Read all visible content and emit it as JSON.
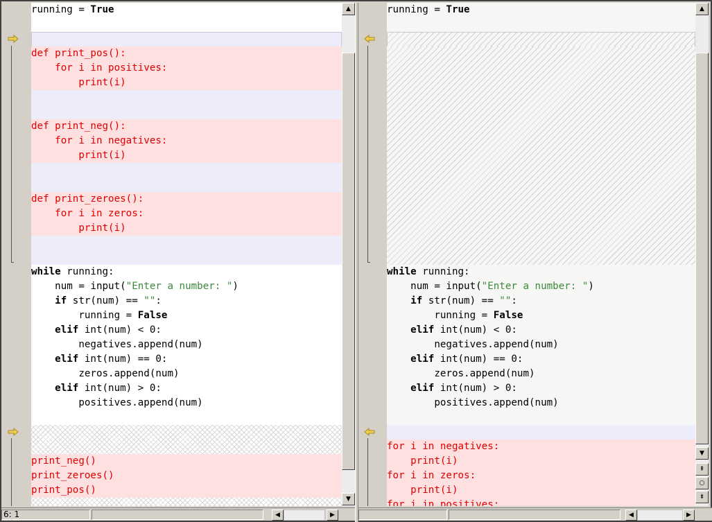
{
  "left": {
    "top_line": "running = True",
    "functions": [
      {
        "def": "def print_pos():",
        "for": "    for i in positives:",
        "print": "        print(i)"
      },
      {
        "def": "def print_neg():",
        "for": "    for i in negatives:",
        "print": "        print(i)"
      },
      {
        "def": "def print_zeroes():",
        "for": "    for i in zeros:",
        "print": "        print(i)"
      }
    ],
    "calls": [
      "print_neg()",
      "print_zeroes()",
      "print_pos()"
    ]
  },
  "right": {
    "top_line": "running = True",
    "loops": [
      "for i in negatives:",
      "    print(i)",
      "for i in zeros:",
      "    print(i)",
      "for i in positives:"
    ]
  },
  "while_block": {
    "l1_kw": "while",
    "l1_rest": " running:",
    "l2_a": "    num = input(",
    "l2_str": "\"Enter a number: \"",
    "l2_b": ")",
    "l3_kw": "    if",
    "l3_rest": " str(num) == ",
    "l3_str": "\"\"",
    "l3_end": ":",
    "l4_a": "        running = ",
    "l4_kw": "False",
    "l5_kw": "    elif",
    "l5_rest": " int(num) < 0:",
    "l6": "        negatives.append(num)",
    "l7_kw": "    elif",
    "l7_rest": " int(num) == 0:",
    "l8": "        zeros.append(num)",
    "l9_kw": "    elif",
    "l9_rest": " int(num) > 0:",
    "l10": "        positives.append(num)"
  },
  "status": {
    "position": "6: 1"
  },
  "colors": {
    "deleted_text": "#e00000",
    "deleted_bg": "#ffe0e0",
    "string": "#3a8a3a",
    "arrow": "#e8c030"
  },
  "icons": {
    "change_marker": "arrow-right-icon",
    "nav_up": "double-up-icon",
    "nav_center": "circle-icon",
    "nav_down": "double-down-icon"
  }
}
